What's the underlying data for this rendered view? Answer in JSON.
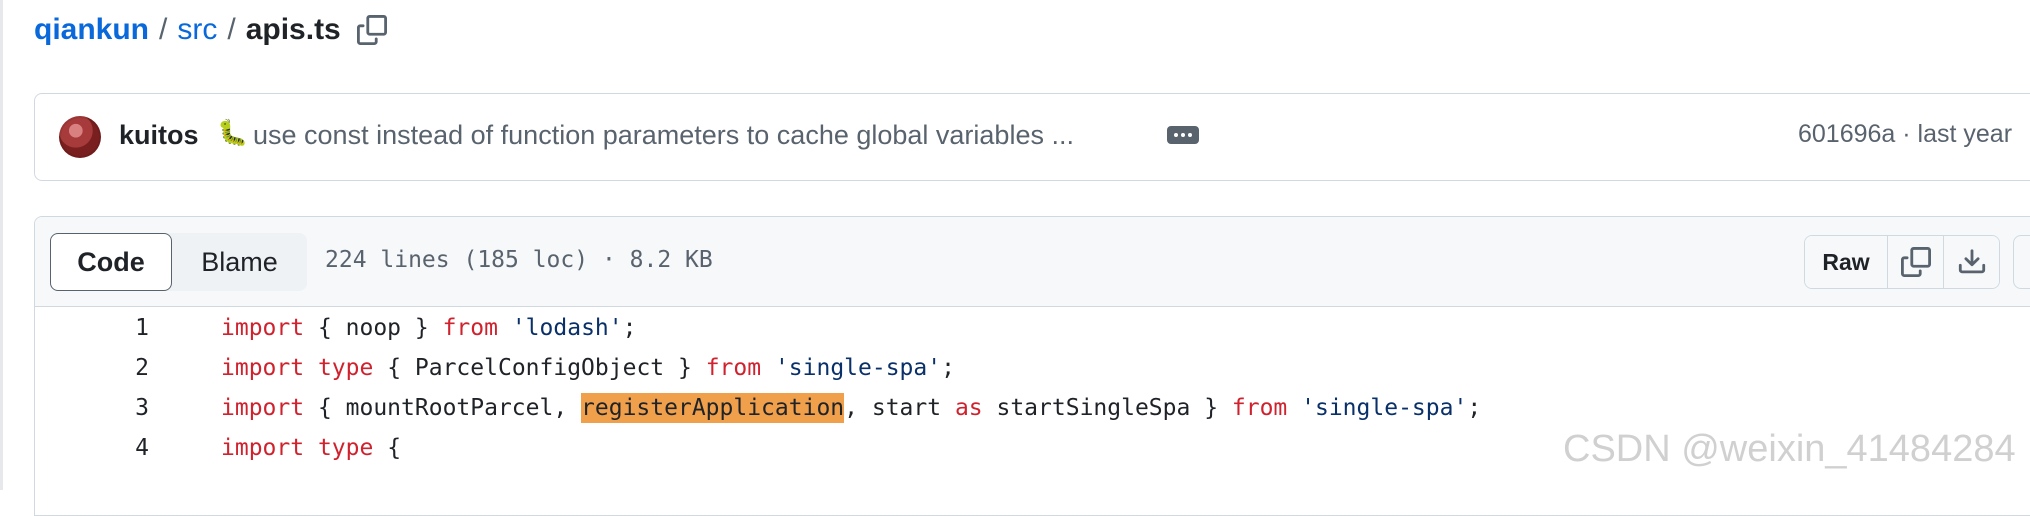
{
  "breadcrumb": {
    "repo": "qiankun",
    "sep1": "/",
    "folder": "src",
    "sep2": "/",
    "file": "apis.ts"
  },
  "commit": {
    "author": "kuitos",
    "emoji": "🐛",
    "message": "use const instead of function parameters to cache global variables ...",
    "meta": "601696a · last year"
  },
  "file": {
    "tabs": {
      "code": "Code",
      "blame": "Blame"
    },
    "info": "224 lines (185 loc) · 8.2 KB",
    "actions": {
      "raw": "Raw"
    }
  },
  "code": {
    "lines": [
      {
        "num": "1",
        "t": [
          "import",
          " { noop } ",
          "from",
          " ",
          "'lodash'",
          ";"
        ]
      },
      {
        "num": "2",
        "t": [
          "import",
          " ",
          "type",
          " { ParcelConfigObject } ",
          "from",
          " ",
          "'single-spa'",
          ";"
        ]
      },
      {
        "num": "3",
        "t": [
          "import",
          " { mountRootParcel, ",
          "registerApplication",
          ", start ",
          "as",
          " startSingleSpa } ",
          "from",
          " ",
          "'single-spa'",
          ";"
        ]
      },
      {
        "num": "4",
        "t": [
          "import",
          " ",
          "type",
          " {"
        ]
      }
    ]
  },
  "watermark": "CSDN @weixin_41484284",
  "colors": {
    "link": "#0969da",
    "keyword": "#cf222e",
    "string": "#0a3069",
    "highlight": "#f0a04b"
  }
}
